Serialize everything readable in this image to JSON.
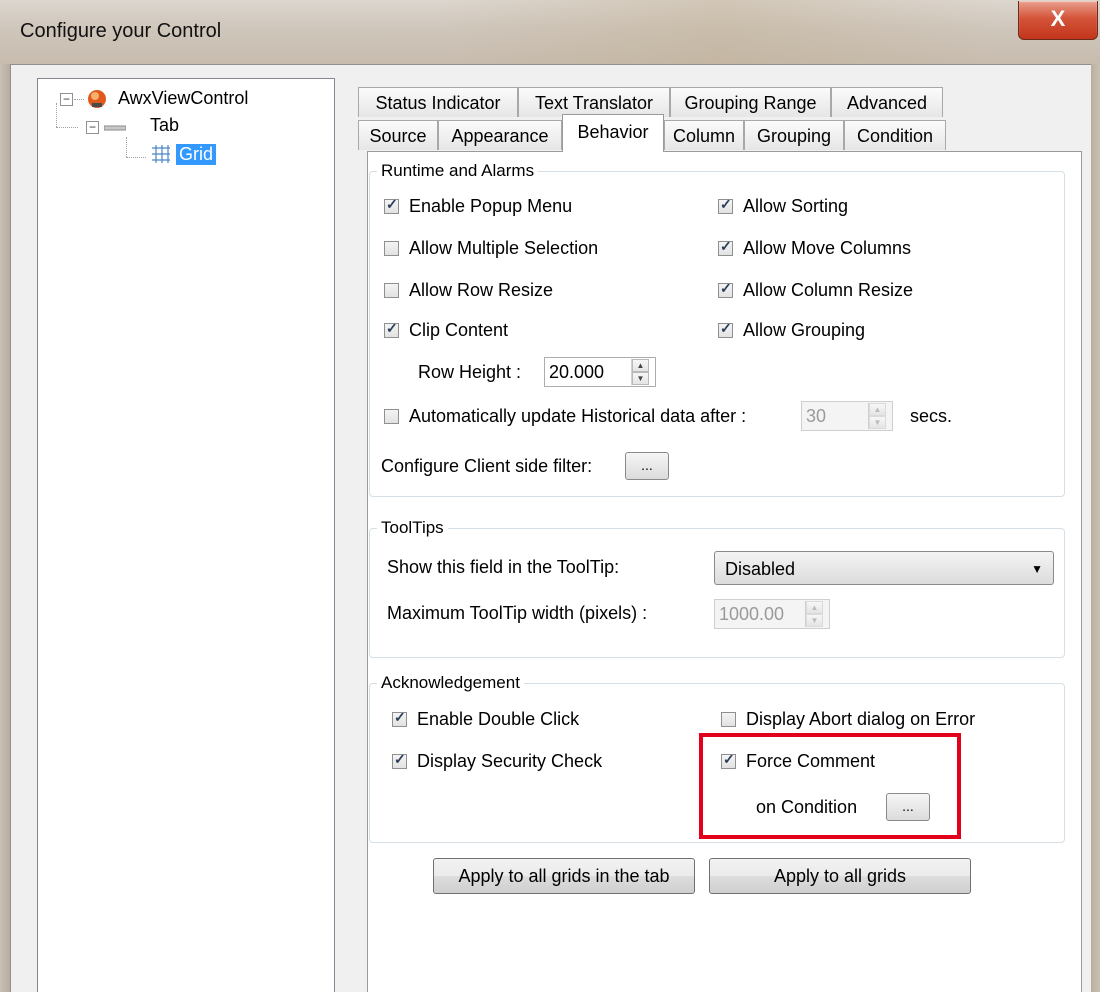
{
  "window": {
    "title": "Configure your Control",
    "close_glyph": "X"
  },
  "tree": {
    "root": {
      "label": "AwxViewControl",
      "expander": "−"
    },
    "tab": {
      "label": "Tab",
      "expander": "−"
    },
    "grid": {
      "label": "Grid",
      "selected": true
    }
  },
  "tabs": {
    "row1": [
      "Status Indicator",
      "Text Translator",
      "Grouping Range",
      "Advanced"
    ],
    "row2": [
      "Source",
      "Appearance",
      "Behavior",
      "Column",
      "Grouping",
      "Condition"
    ],
    "active": "Behavior"
  },
  "runtime": {
    "title": "Runtime and Alarms",
    "enable_popup_menu": {
      "label": "Enable Popup Menu",
      "checked": true
    },
    "allow_multiple_selection": {
      "label": "Allow Multiple Selection",
      "checked": false
    },
    "allow_row_resize": {
      "label": "Allow Row Resize",
      "checked": false
    },
    "clip_content": {
      "label": "Clip Content",
      "checked": true
    },
    "allow_sorting": {
      "label": "Allow Sorting",
      "checked": true
    },
    "allow_move_columns": {
      "label": "Allow Move Columns",
      "checked": true
    },
    "allow_column_resize": {
      "label": "Allow Column Resize",
      "checked": true
    },
    "allow_grouping": {
      "label": "Allow Grouping",
      "checked": true
    },
    "row_height_label": "Row Height :",
    "row_height_value": "20.000",
    "auto_update": {
      "label": "Automatically update Historical data after :",
      "checked": false
    },
    "auto_update_value": "30",
    "secs_label": "secs.",
    "client_filter_label": "Configure Client side filter:",
    "ellipsis": "..."
  },
  "tooltips": {
    "title": "ToolTips",
    "show_field_label": "Show this field in the  ToolTip:",
    "show_field_value": "Disabled",
    "max_width_label": "Maximum ToolTip width (pixels) :",
    "max_width_value": "1000.00"
  },
  "ack": {
    "title": "Acknowledgement",
    "enable_double_click": {
      "label": "Enable Double Click",
      "checked": true
    },
    "display_security_check": {
      "label": "Display Security Check",
      "checked": true
    },
    "display_abort_dialog": {
      "label": "Display Abort dialog on Error",
      "checked": false
    },
    "force_comment": {
      "label": "Force Comment",
      "checked": true
    },
    "on_condition_label": "on Condition",
    "ellipsis": "..."
  },
  "buttons": {
    "apply_tab": "Apply to all grids in the tab",
    "apply_all": "Apply to all grids"
  },
  "colors": {
    "highlight": "#e3001b",
    "selection": "#3399ff"
  },
  "icons": {
    "root": "control-node-icon",
    "tab": "tab-node-icon",
    "grid": "grid-node-icon",
    "dropdown": "chevron-down-icon",
    "spin_up": "spin-up-icon",
    "spin_down": "spin-down-icon"
  }
}
